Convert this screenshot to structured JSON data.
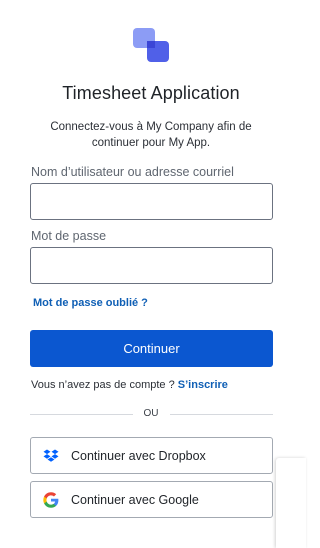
{
  "app": {
    "title": "Timesheet Application",
    "subtitle": "Connectez-vous à My Company afin de continuer pour My App.",
    "logo_icon": "overlapping-squares-logo-icon"
  },
  "form": {
    "username_label": "Nom d’utilisateur ou adresse courriel",
    "username_value": "",
    "password_label": "Mot de passe",
    "password_value": "",
    "forgot_password": "Mot de passe oublié ?",
    "continue_button": "Continuer"
  },
  "signup": {
    "prompt": "Vous n’avez pas de compte ?",
    "link": "S’inscrire"
  },
  "divider": {
    "text": "OU"
  },
  "social": [
    {
      "label": "Continuer avec Dropbox",
      "icon": "dropbox-icon"
    },
    {
      "label": "Continuer avec Google",
      "icon": "google-icon"
    }
  ],
  "colors": {
    "primary": "#0b57d0",
    "link": "#0f5fb5",
    "logo_light": "#8c9cf5",
    "logo_dark": "#5060e8"
  }
}
